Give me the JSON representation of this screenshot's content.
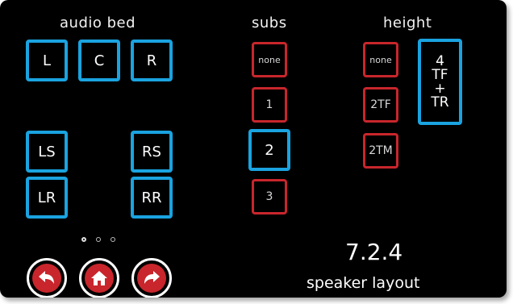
{
  "headers": {
    "audio_bed": "audio bed",
    "subs": "subs",
    "height": "height"
  },
  "audio_bed": {
    "left": "L",
    "center": "C",
    "right": "R",
    "left_surround": "LS",
    "right_surround": "RS",
    "left_rear": "LR",
    "right_rear": "RR"
  },
  "subs": {
    "none": "none",
    "one": "1",
    "two": "2",
    "three": "3",
    "selected": "2"
  },
  "height": {
    "none": "none",
    "two_tf": "2TF",
    "two_tm": "2TM",
    "four_line1": "4",
    "four_line2": "TF",
    "four_line3": "+",
    "four_line4": "TR",
    "selected": "4 TF + TR"
  },
  "pagination": {
    "total": 3,
    "active": 1
  },
  "nav": {
    "back_icon": "back-arrow-icon",
    "home_icon": "home-icon",
    "forward_icon": "forward-arrow-icon"
  },
  "layout_summary": {
    "value": "7.2.4",
    "label": "speaker layout"
  },
  "colors": {
    "selected": "#1aa3e0",
    "unselected": "#c8262c",
    "background": "#000000",
    "nav_fill": "#c8262c"
  }
}
